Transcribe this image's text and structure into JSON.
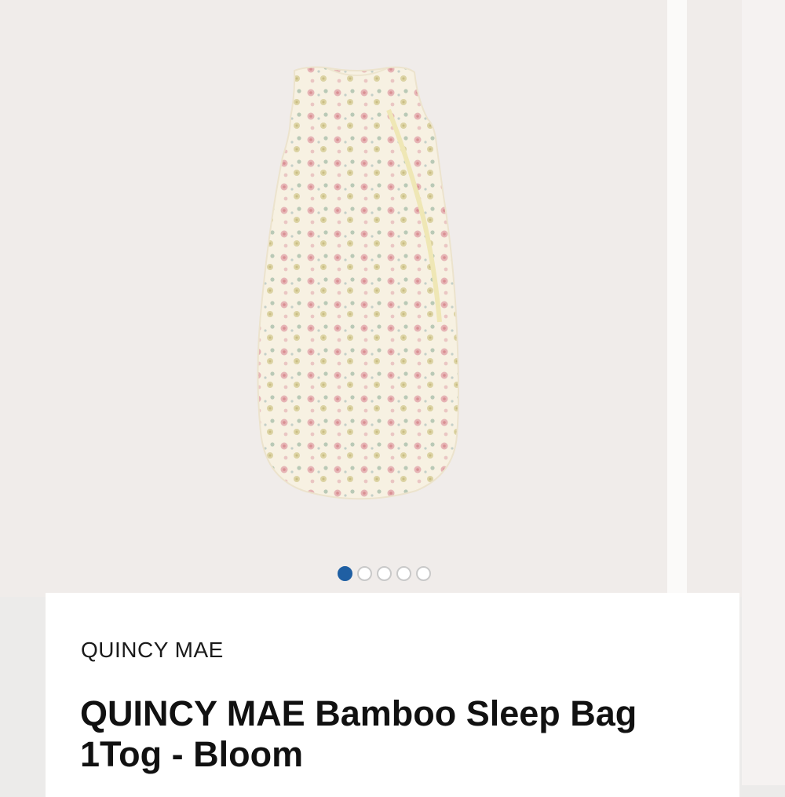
{
  "gallery": {
    "image_alt": "Floral print sleeveless sleep bag",
    "dot_count": 5,
    "active_index": 0
  },
  "product": {
    "brand": "QUINCY MAE",
    "title": "QUINCY MAE Bamboo Sleep Bag 1Tog - Bloom"
  },
  "colors": {
    "accent": "#1f5fa3",
    "gallery_bg": "#f0ecea",
    "card_bg": "#ffffff"
  }
}
